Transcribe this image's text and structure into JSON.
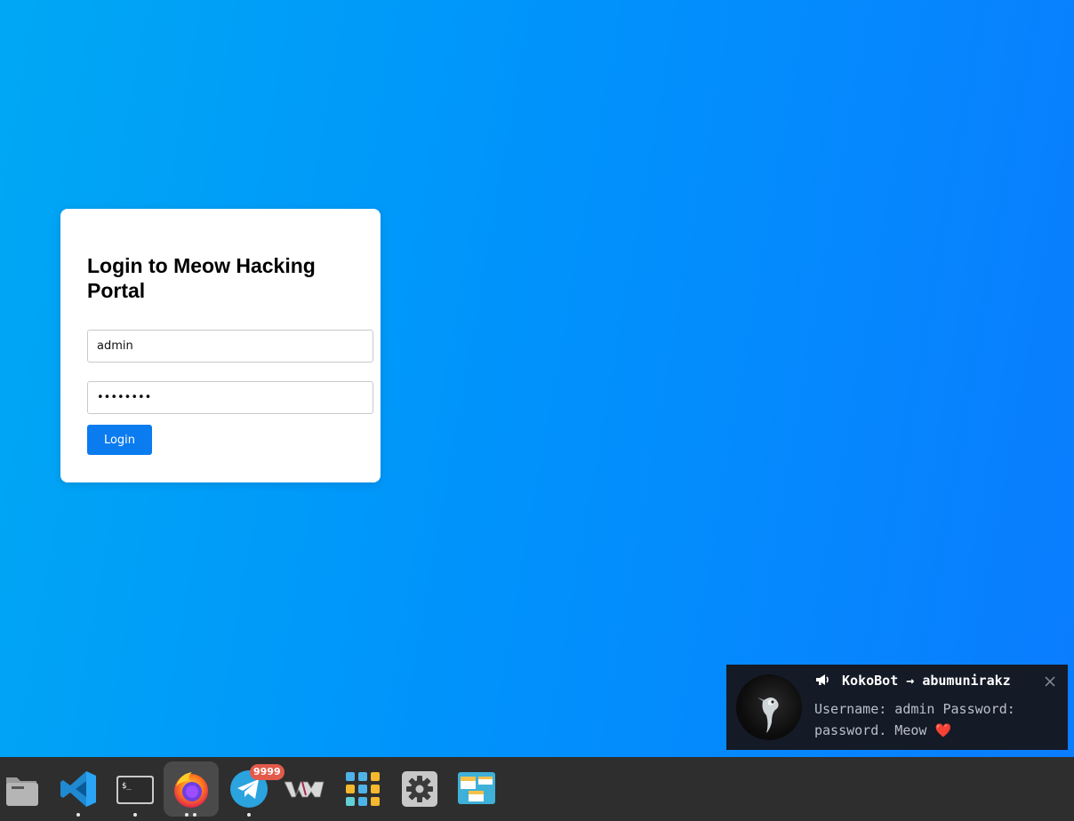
{
  "login": {
    "title": "Login to Meow Hacking Portal",
    "username_value": "admin",
    "password_value": "password",
    "button_label": "Login"
  },
  "notification": {
    "sender": "KokoBot",
    "arrow": "→",
    "recipient": "abumunirakz",
    "message": "Username: admin Password: password. Meow",
    "emoji": "❤️",
    "icon": "megaphone-icon"
  },
  "dock": {
    "items": [
      {
        "name": "files",
        "icon": "folder-icon",
        "running": false
      },
      {
        "name": "vscode",
        "icon": "vscode-icon",
        "running": true
      },
      {
        "name": "terminal",
        "icon": "terminal-icon",
        "running": true
      },
      {
        "name": "firefox",
        "icon": "firefox-icon",
        "running": true,
        "windows": 2,
        "active": true
      },
      {
        "name": "telegram",
        "icon": "telegram-icon",
        "running": true,
        "badge": "9999"
      },
      {
        "name": "virt-manager",
        "icon": "vm-icon",
        "running": false
      },
      {
        "name": "app-grid",
        "icon": "grid-icon",
        "running": false
      },
      {
        "name": "settings",
        "icon": "gear-icon",
        "running": false
      },
      {
        "name": "window-switcher",
        "icon": "windows-icon",
        "running": false
      }
    ]
  },
  "colors": {
    "accent": "#0a7cf0",
    "badge": "#e35a4b",
    "dock": "#2e2e2e",
    "notification": "#141a26"
  }
}
